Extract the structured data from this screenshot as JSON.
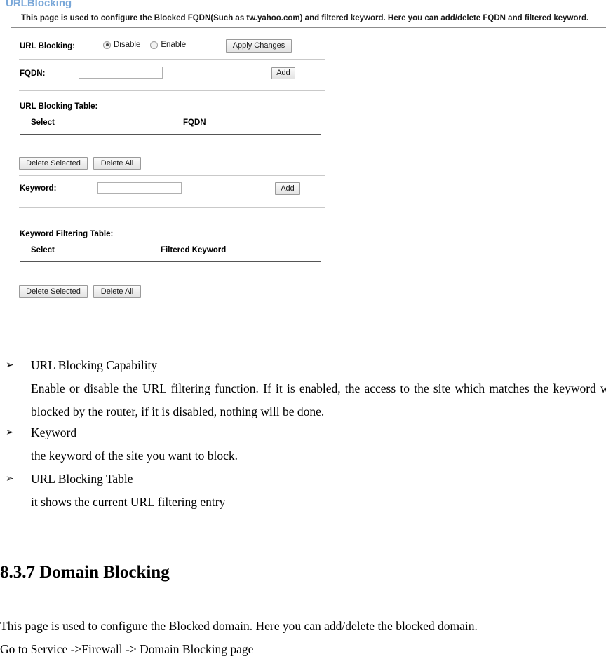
{
  "router_page": {
    "title": "URLBlocking",
    "description": "This page is used to configure the Blocked FQDN(Such as tw.yahoo.com) and filtered keyword. Here you can add/delete FQDN and filtered keyword.",
    "url_blocking": {
      "label": "URL Blocking:",
      "options": [
        {
          "label": "Disable",
          "selected": true
        },
        {
          "label": "Enable",
          "selected": false
        }
      ],
      "apply_button": "Apply Changes"
    },
    "fqdn_row": {
      "label": "FQDN:",
      "input_value": "",
      "input_placeholder": "",
      "add_button": "Add"
    },
    "url_blocking_table": {
      "caption": "URL Blocking Table:",
      "columns": [
        "Select",
        "FQDN"
      ],
      "rows": [],
      "delete_selected_button": "Delete Selected",
      "delete_all_button": "Delete All"
    },
    "keyword_row": {
      "label": "Keyword:",
      "input_value": "",
      "input_placeholder": "",
      "add_button": "Add"
    },
    "keyword_filtering_table": {
      "caption": "Keyword Filtering Table:",
      "columns": [
        "Select",
        "Filtered Keyword"
      ],
      "rows": [],
      "delete_selected_button": "Delete Selected",
      "delete_all_button": "Delete All"
    },
    "accent_color": "#79a7d8"
  },
  "manual": {
    "bullet_glyph": "➢",
    "bullets": [
      {
        "title": "URL Blocking Capability",
        "text": "Enable or disable the URL filtering function. If it is enabled, the access to the site which matches the keyword will be blocked by the router, if it is disabled, nothing will be done."
      },
      {
        "title": "Keyword",
        "text": "the keyword of the site you want to block."
      },
      {
        "title": "URL Blocking Table",
        "text": "it shows the current URL filtering entry"
      }
    ],
    "section_heading": "8.3.7 Domain Blocking",
    "closing_lines": [
      "This page is used to configure the Blocked domain. Here you can add/delete the blocked domain.",
      "Go to Service ->Firewall -> Domain Blocking page"
    ]
  }
}
